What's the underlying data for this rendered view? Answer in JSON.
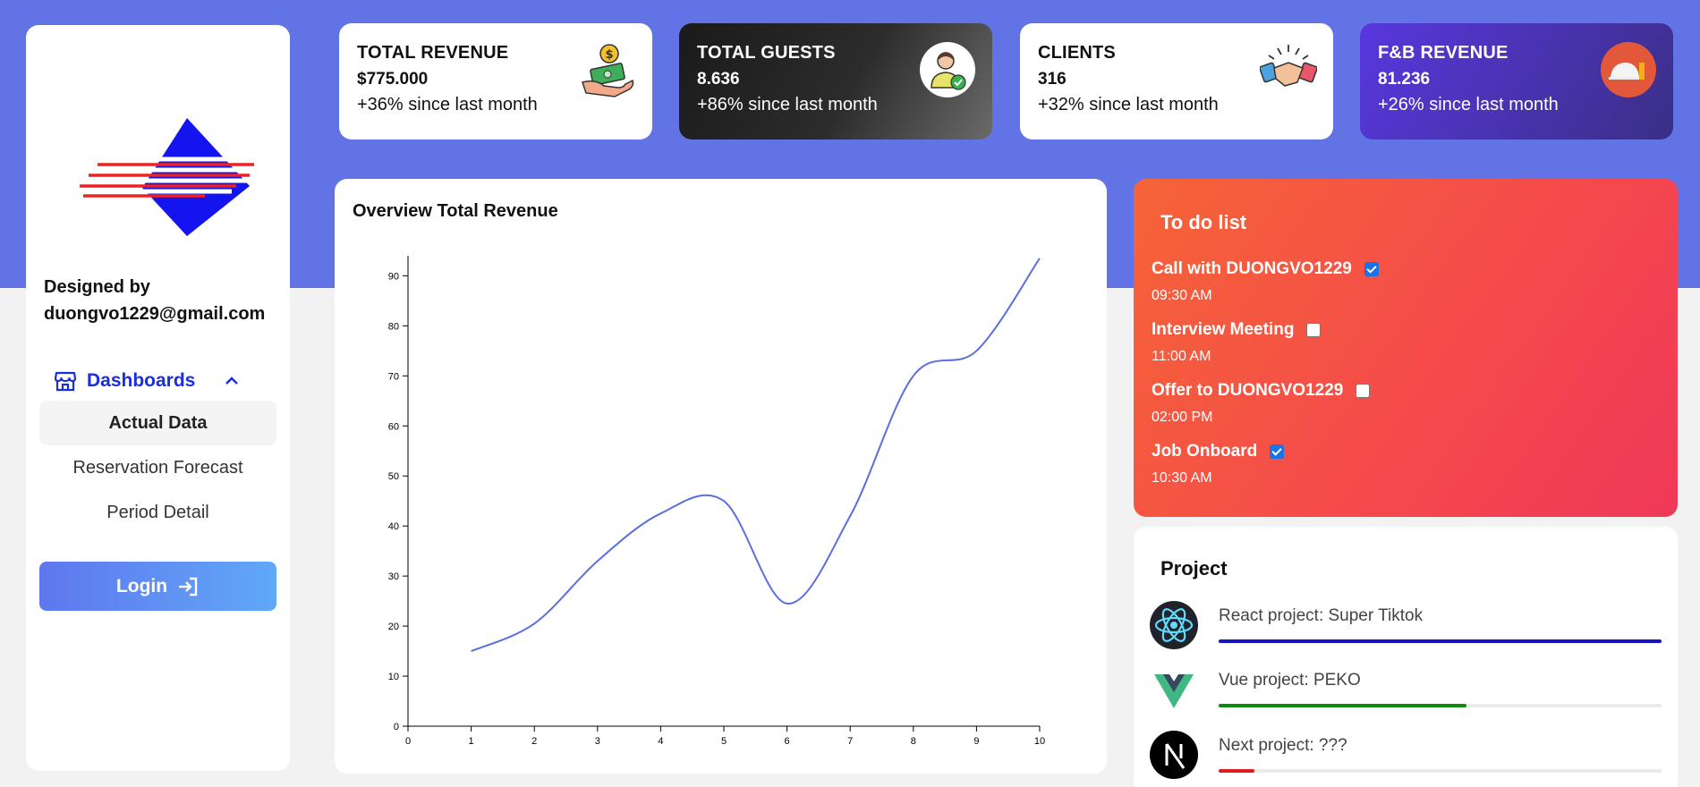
{
  "sidebar": {
    "designed_by_line1": "Designed by",
    "designed_by_line2": "duongvo1229@gmail.com",
    "nav_section": "Dashboards",
    "nav_items": [
      "Actual Data",
      "Reservation Forecast",
      "Period Detail"
    ],
    "active_item": "Actual Data",
    "login_label": "Login",
    "accent_color": "#1a2ee0"
  },
  "stats": [
    {
      "title": "TOTAL REVENUE",
      "value": "$775.000",
      "delta": "+36% since last month",
      "icon": "money-hand-icon"
    },
    {
      "title": "TOTAL GUESTS",
      "value": "8.636",
      "delta": "+86% since last month",
      "icon": "guest-user-icon"
    },
    {
      "title": "CLIENTS",
      "value": "316",
      "delta": "+32% since last month",
      "icon": "handshake-icon"
    },
    {
      "title": "F&B REVENUE",
      "value": "81.236",
      "delta": "+26% since last month",
      "icon": "food-dome-icon"
    }
  ],
  "chart_data": {
    "type": "line",
    "title": "Overview Total Revenue",
    "x": [
      1,
      2,
      3,
      4,
      5,
      6,
      7,
      8,
      9,
      10
    ],
    "y": [
      15,
      20.5,
      33,
      42.5,
      45,
      24.5,
      42,
      70,
      75,
      93.5
    ],
    "xlim": [
      0,
      10
    ],
    "ylim": [
      0,
      94
    ],
    "xticks": [
      "0",
      "1",
      "2",
      "3",
      "4",
      "5",
      "6",
      "7",
      "8",
      "9",
      "10"
    ],
    "yticks": [
      "0",
      "10",
      "20",
      "30",
      "40",
      "50",
      "60",
      "70",
      "80",
      "90"
    ],
    "line_color": "#5b6fe0",
    "grid": false
  },
  "todo": {
    "title": "To do list",
    "items": [
      {
        "label": "Call with DUONGVO1229",
        "time": "09:30 AM",
        "checked": true
      },
      {
        "label": "Interview Meeting",
        "time": "11:00 AM",
        "checked": false
      },
      {
        "label": "Offer to DUONGVO1229",
        "time": "02:00 PM",
        "checked": false
      },
      {
        "label": "Job Onboard",
        "time": "10:30 AM",
        "checked": true
      }
    ]
  },
  "project": {
    "title": "Project",
    "items": [
      {
        "name": "React project: Super Tiktok",
        "icon": "react-logo-icon",
        "progress": 1.0,
        "color": "#1414c8"
      },
      {
        "name": "Vue project: PEKO",
        "icon": "vue-logo-icon",
        "progress": 0.56,
        "color": "#0e8a0e"
      },
      {
        "name": "Next project: ???",
        "icon": "next-logo-icon",
        "progress": 0.08,
        "color": "#e01b1b"
      }
    ]
  }
}
